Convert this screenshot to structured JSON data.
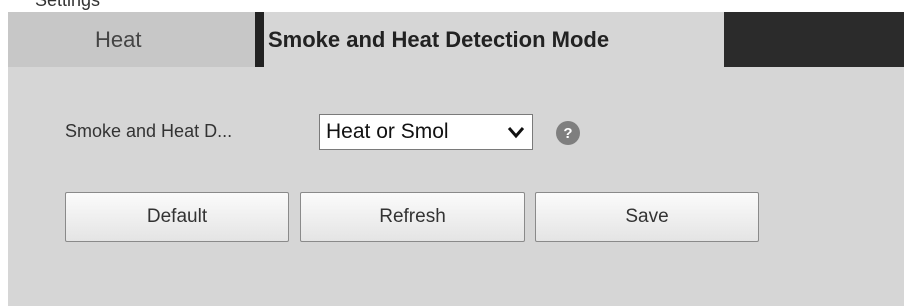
{
  "header": {
    "partial_text": "Settings"
  },
  "tabs": [
    {
      "label": "Heat",
      "active": false
    },
    {
      "label": "Smoke and Heat Detection Mode",
      "active": true
    }
  ],
  "form": {
    "field_label": "Smoke and Heat D...",
    "select_value": "Heat or Smol",
    "help_icon": "help-icon",
    "help_glyph": "?"
  },
  "buttons": {
    "default_label": "Default",
    "refresh_label": "Refresh",
    "save_label": "Save"
  },
  "colors": {
    "panel_bg": "#d6d6d6",
    "inactive_tab_bg": "#c7c7c7",
    "dark_tab_bg": "#2b2b2b"
  }
}
